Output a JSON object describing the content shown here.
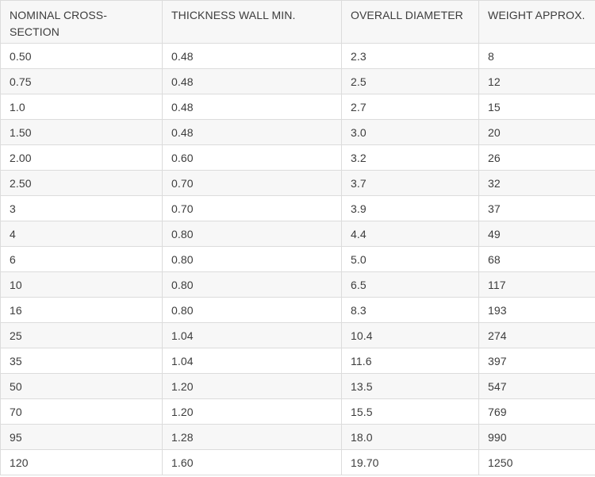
{
  "table": {
    "headers": [
      "NOMINAL CROSS-SECTION",
      "THICKNESS WALL MIN.",
      "OVERALL DIAMETER",
      "WEIGHT APPROX."
    ],
    "rows": [
      [
        "0.50",
        "0.48",
        "2.3",
        "8"
      ],
      [
        "0.75",
        "0.48",
        "2.5",
        "12"
      ],
      [
        "1.0",
        "0.48",
        "2.7",
        "15"
      ],
      [
        "1.50",
        "0.48",
        "3.0",
        "20"
      ],
      [
        "2.00",
        "0.60",
        "3.2",
        "26"
      ],
      [
        "2.50",
        "0.70",
        "3.7",
        "32"
      ],
      [
        "3",
        "0.70",
        "3.9",
        "37"
      ],
      [
        "4",
        "0.80",
        "4.4",
        "49"
      ],
      [
        "6",
        "0.80",
        "5.0",
        "68"
      ],
      [
        "10",
        "0.80",
        "6.5",
        "117"
      ],
      [
        "16",
        "0.80",
        "8.3",
        "193"
      ],
      [
        "25",
        "1.04",
        "10.4",
        "274"
      ],
      [
        "35",
        "1.04",
        "11.6",
        "397"
      ],
      [
        "50",
        "1.20",
        "13.5",
        "547"
      ],
      [
        "70",
        "1.20",
        "15.5",
        "769"
      ],
      [
        "95",
        "1.28",
        "18.0",
        "990"
      ],
      [
        "120",
        "1.60",
        "19.70",
        "1250"
      ]
    ]
  }
}
